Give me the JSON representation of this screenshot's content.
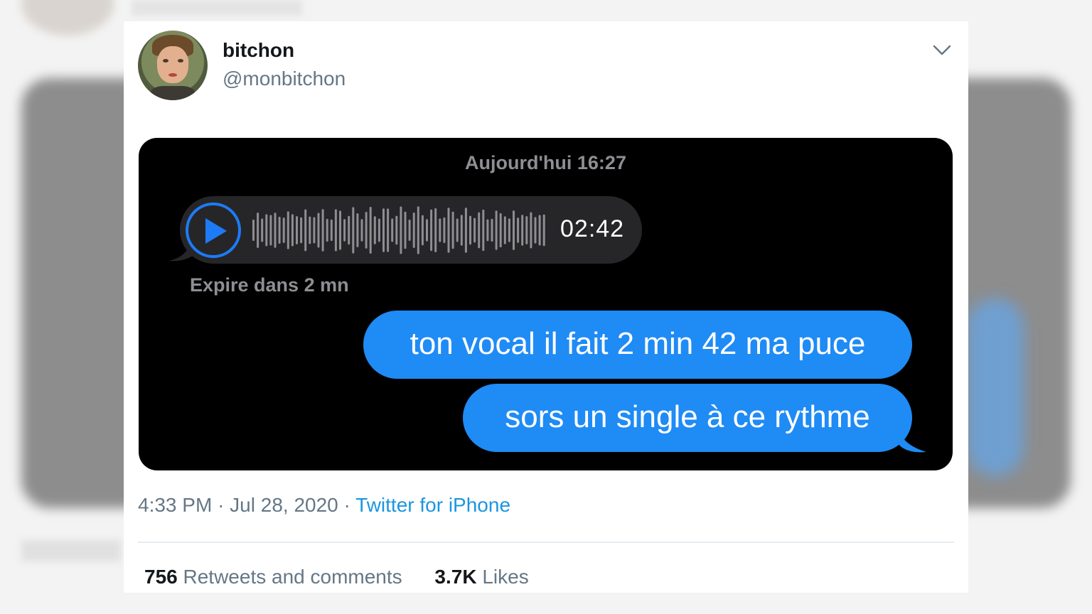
{
  "tweet": {
    "display_name": "bitchon",
    "handle": "@monbitchon",
    "time": "4:33 PM",
    "date": "Jul 28, 2020",
    "source": "Twitter for iPhone",
    "separator": "·",
    "retweets_count": "756",
    "retweets_label": "Retweets and comments",
    "likes_count": "3.7K",
    "likes_label": "Likes"
  },
  "imessage": {
    "date_header": "Aujourd'hui 16:27",
    "audio_duration": "02:42",
    "expire_text": "Expire dans 2 mn",
    "messages": [
      "ton vocal il fait 2 min 42 ma puce",
      "sors un single à ce rythme"
    ]
  },
  "colors": {
    "accent_blue": "#1b95e0",
    "imessage_blue": "#1f8bf5",
    "screenshot_bg": "#000000"
  },
  "icons": [
    "chevron-down-icon",
    "play-icon",
    "waveform-icon"
  ]
}
